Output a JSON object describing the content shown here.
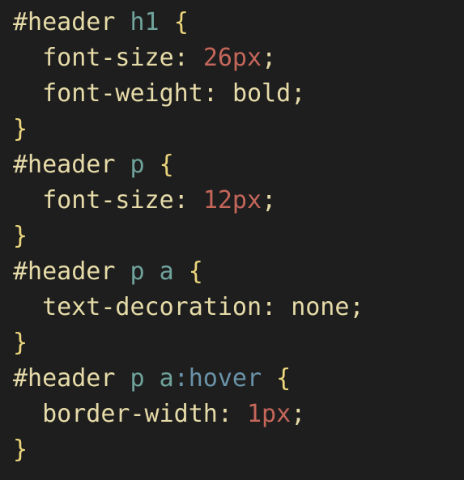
{
  "code": {
    "lines": [
      [
        {
          "type": "selector",
          "text": "#header"
        },
        {
          "type": "plain",
          "text": " "
        },
        {
          "type": "element",
          "text": "h1"
        },
        {
          "type": "plain",
          "text": " "
        },
        {
          "type": "brace",
          "text": "{"
        }
      ],
      [
        {
          "type": "indent",
          "text": "  "
        },
        {
          "type": "property",
          "text": "font-size"
        },
        {
          "type": "colon",
          "text": ": "
        },
        {
          "type": "number",
          "text": "26px"
        },
        {
          "type": "semi",
          "text": ";"
        }
      ],
      [
        {
          "type": "indent",
          "text": "  "
        },
        {
          "type": "property",
          "text": "font-weight"
        },
        {
          "type": "colon",
          "text": ": "
        },
        {
          "type": "keyword",
          "text": "bold"
        },
        {
          "type": "semi",
          "text": ";"
        }
      ],
      [
        {
          "type": "brace",
          "text": "}"
        }
      ],
      [
        {
          "type": "selector",
          "text": "#header"
        },
        {
          "type": "plain",
          "text": " "
        },
        {
          "type": "element",
          "text": "p"
        },
        {
          "type": "plain",
          "text": " "
        },
        {
          "type": "brace",
          "text": "{"
        }
      ],
      [
        {
          "type": "indent",
          "text": "  "
        },
        {
          "type": "property",
          "text": "font-size"
        },
        {
          "type": "colon",
          "text": ": "
        },
        {
          "type": "number",
          "text": "12px"
        },
        {
          "type": "semi",
          "text": ";"
        }
      ],
      [
        {
          "type": "brace",
          "text": "}"
        }
      ],
      [
        {
          "type": "selector",
          "text": "#header"
        },
        {
          "type": "plain",
          "text": " "
        },
        {
          "type": "element",
          "text": "p"
        },
        {
          "type": "plain",
          "text": " "
        },
        {
          "type": "element",
          "text": "a"
        },
        {
          "type": "plain",
          "text": " "
        },
        {
          "type": "brace",
          "text": "{"
        }
      ],
      [
        {
          "type": "indent",
          "text": "  "
        },
        {
          "type": "property",
          "text": "text-decoration"
        },
        {
          "type": "colon",
          "text": ": "
        },
        {
          "type": "keyword",
          "text": "none"
        },
        {
          "type": "semi",
          "text": ";"
        }
      ],
      [
        {
          "type": "brace",
          "text": "}"
        }
      ],
      [
        {
          "type": "selector",
          "text": "#header"
        },
        {
          "type": "plain",
          "text": " "
        },
        {
          "type": "element",
          "text": "p"
        },
        {
          "type": "plain",
          "text": " "
        },
        {
          "type": "element",
          "text": "a"
        },
        {
          "type": "pseudo",
          "text": ":hover"
        },
        {
          "type": "plain",
          "text": " "
        },
        {
          "type": "brace",
          "text": "{"
        }
      ],
      [
        {
          "type": "indent",
          "text": "  "
        },
        {
          "type": "property",
          "text": "border-width"
        },
        {
          "type": "colon",
          "text": ": "
        },
        {
          "type": "number",
          "text": "1px"
        },
        {
          "type": "semi",
          "text": ";"
        }
      ],
      [
        {
          "type": "brace",
          "text": "}"
        }
      ]
    ]
  },
  "colors": {
    "background": "#1e1e1e",
    "selector": "#e6dba8",
    "element": "#6fa39c",
    "brace": "#ecd67c",
    "number": "#c5665a",
    "pseudo": "#6a93a9"
  }
}
